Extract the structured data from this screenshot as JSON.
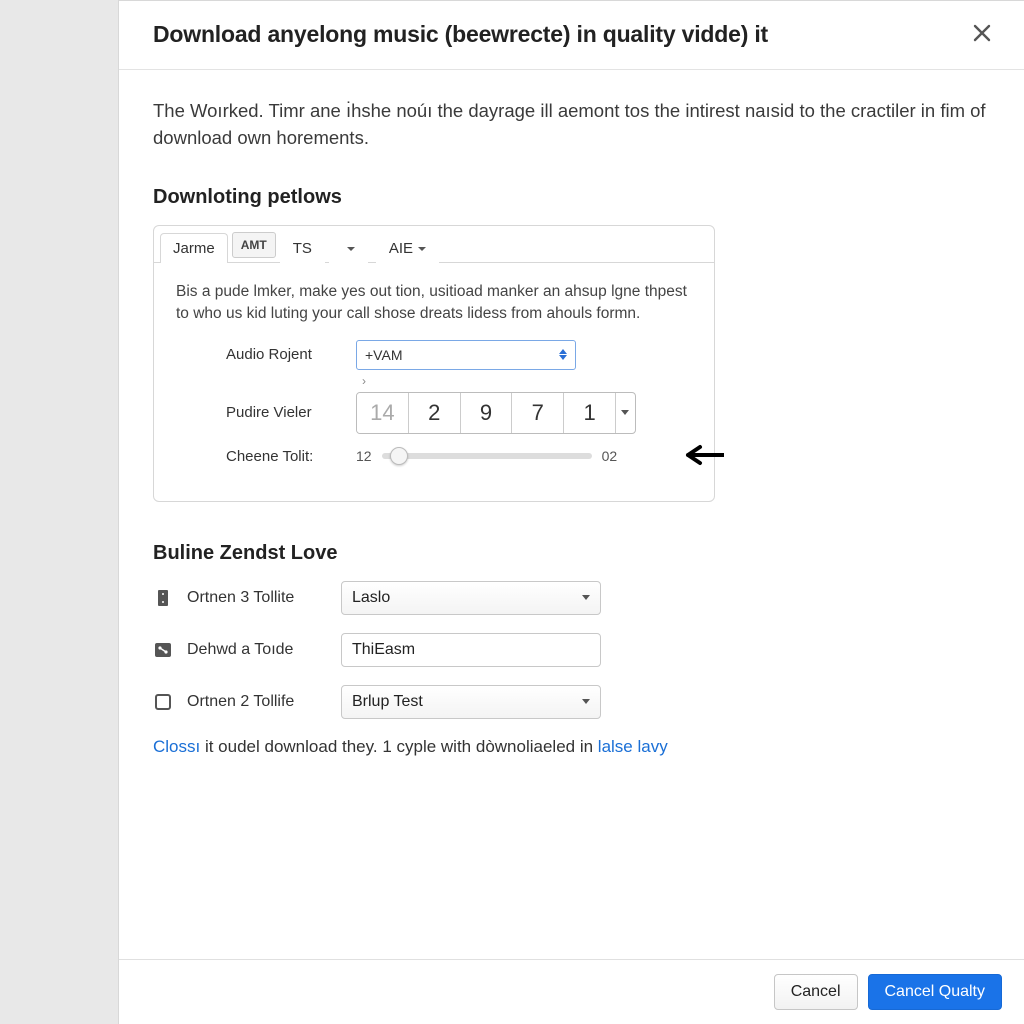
{
  "dialog": {
    "title": "Download anyelong music (beewrecte) in quality vidde) it",
    "intro": "The Woırked. Timr ane ı̇hshe noúı the dayrage ill aemont tos the intirest naısid to the cractiler in fim of download own horements."
  },
  "section1": {
    "heading": "Downloting petlows",
    "tabs": {
      "t0": "Jarme",
      "t1": "AMT",
      "t2": "TS",
      "t3": "AIE"
    },
    "desc": "Bis a pude lmker, make yes out tion, usitioad manker an ahsup lgne thpest to who us kid luting your call shose dreats lidess from ahouls formn.",
    "audio_label": "Audio Rojent",
    "audio_value": "+VAM",
    "viler_label": "Pudire Vieler",
    "viler_values": [
      "14",
      "2",
      "9",
      "7",
      "1"
    ],
    "toli_label": "Cheene Tolit:",
    "toli_start": "12",
    "toli_end": "02"
  },
  "section2": {
    "heading": "Buline Zendst Love",
    "rows": [
      {
        "icon": "storage",
        "label": "Ortnen 3 Tollite",
        "value": "Laslo",
        "type": "select"
      },
      {
        "icon": "flow",
        "label": "Dehwd a Toıde",
        "value": "ThiEasm",
        "type": "text"
      },
      {
        "icon": "device",
        "label": "Ortnen 2 Tollife",
        "value": "Brlup Test",
        "type": "select"
      }
    ]
  },
  "help": {
    "link1": "Clossı",
    "mid": " it oudel download they. 1 cyple with dòwnoliaeled in ",
    "link2": "lalse lavy"
  },
  "footer": {
    "cancel": "Cancel",
    "primary": "Cancel Qualty"
  }
}
